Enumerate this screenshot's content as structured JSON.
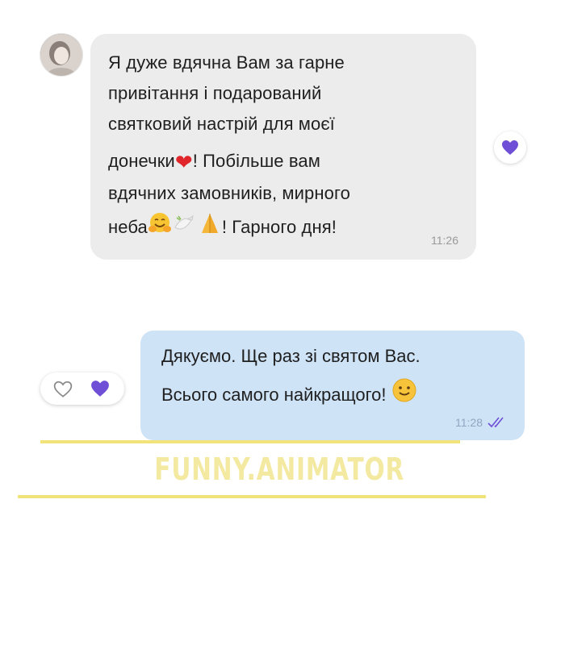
{
  "incoming": {
    "lines": [
      "Я дуже вдячна Вам за  гарне",
      "привітання і подарований",
      "святковий настрій для моєї",
      "донечки",
      "! Побільше вам",
      "вдячних замовників, мирного",
      "неба",
      "! Гарного дня!"
    ],
    "emoji": {
      "heart": "❤️",
      "hug": "🤗",
      "dove": "🕊",
      "pray": "🙏"
    },
    "time": "11:26"
  },
  "outgoing": {
    "lines": [
      "Дякуємо. Ще раз зі святом Вас.",
      "Всього самого найкращого!"
    ],
    "emoji": {
      "smile": "🙂"
    },
    "time": "11:28"
  },
  "watermark": "FUNNY.ANIMATOR",
  "colors": {
    "incoming_bubble": "#ececec",
    "outgoing_bubble": "#cfe3f7",
    "reaction_heart": "#6e4fd6",
    "underline": "#f1e27a"
  }
}
